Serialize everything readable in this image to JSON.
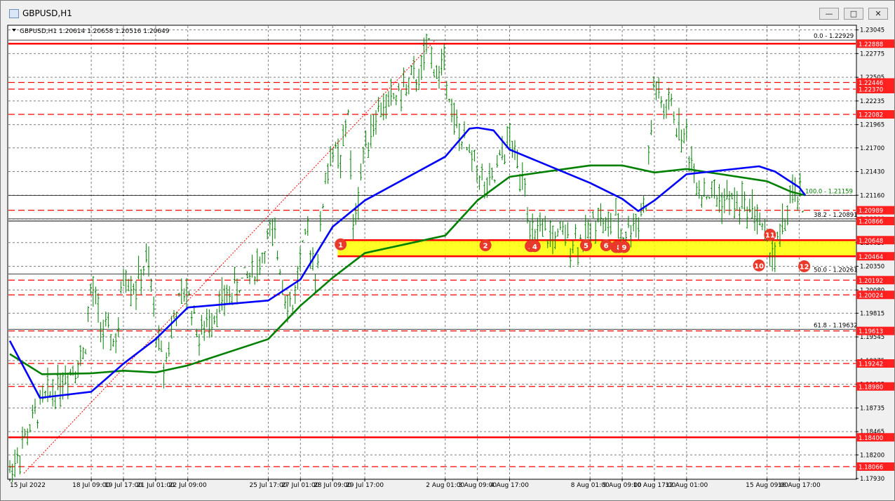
{
  "window": {
    "title": "GBPUSD,H1",
    "buttons": {
      "minimize": "—",
      "maximize": "□",
      "close": "✕"
    }
  },
  "chart_header": "GBPUSD,H1  1.20614 1.20658 1.20516 1.20649",
  "colors": {
    "price_label_bg": "#ff2020",
    "support_zone": "#ffff00",
    "sma100": "#0000ff",
    "sma200": "#008000",
    "bars": "#008000",
    "grid": "#7f7f7f"
  },
  "chart_data": {
    "type": "line",
    "series_type": "ohlc-hourly-bars",
    "symbol": "GBPUSD",
    "timeframe": "H1",
    "ohlc_last": {
      "open": 1.20614,
      "high": 1.20658,
      "low": 1.20516,
      "close": 1.20649
    },
    "ylim": [
      1.1793,
      1.2309
    ],
    "y_ticks": [
      "1.23045",
      "1.22775",
      "1.22505",
      "1.22235",
      "1.21965",
      "1.21700",
      "1.21430",
      "1.21160",
      "1.20890",
      "1.20620",
      "1.20350",
      "1.20080",
      "1.19815",
      "1.19545",
      "1.19275",
      "1.19005",
      "1.18735",
      "1.18465",
      "1.18200",
      "1.17930"
    ],
    "x_ticks": [
      "15 Jul 2022",
      "18 Jul 09:00",
      "19 Jul 17:00",
      "21 Jul 01:00",
      "22 Jul 09:00",
      "25 Jul 17:00",
      "27 Jul 01:00",
      "28 Jul 09:00",
      "29 Jul 17:00",
      "2 Aug 01:00",
      "3 Aug 09:00",
      "4 Aug 17:00",
      "8 Aug 01:00",
      "9 Aug 09:00",
      "10 Aug 17:00",
      "12 Aug 01:00",
      "15 Aug 09:00",
      "16 Aug 17:00"
    ],
    "levels": [
      {
        "value": 1.22888,
        "label": "1.22888",
        "style": "solid"
      },
      {
        "value": 1.22446,
        "label": "1.22446",
        "style": "dashed"
      },
      {
        "value": 1.2237,
        "label": "1.22370",
        "style": "dashed"
      },
      {
        "value": 1.22082,
        "label": "1.22082",
        "style": "dashed"
      },
      {
        "value": 1.20989,
        "label": "1.20989",
        "style": "dashed"
      },
      {
        "value": 1.20866,
        "label": "1.20866",
        "style": "black"
      },
      {
        "value": 1.20648,
        "label": "1.20648",
        "style": "solid"
      },
      {
        "value": 1.20464,
        "label": "1.20464",
        "style": "solid"
      },
      {
        "value": 1.20192,
        "label": "1.20192",
        "style": "dashed"
      },
      {
        "value": 1.20024,
        "label": "1.20024",
        "style": "dashed"
      },
      {
        "value": 1.19613,
        "label": "1.19613",
        "style": "dashed"
      },
      {
        "value": 1.19242,
        "label": "1.19242",
        "style": "dashed"
      },
      {
        "value": 1.1898,
        "label": "1.18980",
        "style": "dashed"
      },
      {
        "value": 1.184,
        "label": "1.18400",
        "style": "solid"
      },
      {
        "value": 1.18066,
        "label": "1.18066",
        "style": "dashed"
      }
    ],
    "fibonacci": [
      {
        "value": 1.22929,
        "label": "0.0 - 1.22929"
      },
      {
        "value": 1.21159,
        "label": "100.0 - 1.21159"
      },
      {
        "value": 1.20891,
        "label": "38.2 - 1.20891"
      },
      {
        "value": 1.20261,
        "label": "50.0 - 1.20261"
      },
      {
        "value": 1.19632,
        "label": "61.8 - 1.19632"
      }
    ],
    "support_zone": {
      "low": 1.20464,
      "high": 1.20648
    },
    "touch_markers": [
      {
        "label": "1",
        "x": "28 Jul 17:00",
        "y": 1.206
      },
      {
        "label": "2",
        "x": "3 Aug 17:00",
        "y": 1.2059
      },
      {
        "label": "3",
        "x": "5 Aug 14:00",
        "y": 1.2058
      },
      {
        "label": "4",
        "x": "5 Aug 18:00",
        "y": 1.2058
      },
      {
        "label": "5",
        "x": "7 Aug 21:00",
        "y": 1.2059
      },
      {
        "label": "6",
        "x": "8 Aug 17:00",
        "y": 1.2059
      },
      {
        "label": "7",
        "x": "9 Aug 03:00",
        "y": 1.2057
      },
      {
        "label": "8",
        "x": "9 Aug 06:00",
        "y": 1.2057
      },
      {
        "label": "9",
        "x": "9 Aug 11:00",
        "y": 1.2057
      },
      {
        "label": "10",
        "x": "15 Aug 01:00",
        "y": 1.2036
      },
      {
        "label": "11",
        "x": "15 Aug 12:00",
        "y": 1.2071
      },
      {
        "label": "12",
        "x": "16 Aug 22:00",
        "y": 1.2035
      }
    ],
    "price_path": [
      [
        "15 Jul 2022",
        1.1802
      ],
      [
        "16 Jul 08:00",
        1.188
      ],
      [
        "18 Jul 02:00",
        1.1935
      ],
      [
        "18 Jul 09:00",
        1.2012
      ],
      [
        "18 Jul 21:00",
        1.196
      ],
      [
        "19 Jul 11:00",
        1.1948
      ],
      [
        "19 Jul 17:00",
        1.203
      ],
      [
        "20 Jul 05:00",
        1.201
      ],
      [
        "20 Jul 17:00",
        1.2042
      ],
      [
        "21 Jul 01:00",
        1.1965
      ],
      [
        "21 Jul 09:00",
        1.192
      ],
      [
        "21 Jul 21:00",
        1.1985
      ],
      [
        "22 Jul 09:00",
        1.2008
      ],
      [
        "22 Jul 21:00",
        1.195
      ],
      [
        "23 Jul 08:00",
        1.198
      ],
      [
        "25 Jul 09:00",
        1.204
      ],
      [
        "25 Jul 17:00",
        1.207
      ],
      [
        "26 Jul 01:00",
        1.206
      ],
      [
        "26 Jul 09:00",
        1.201
      ],
      [
        "26 Jul 17:00",
        1.1985
      ],
      [
        "27 Jul 01:00",
        1.2045
      ],
      [
        "27 Jul 09:00",
        1.207
      ],
      [
        "27 Jul 17:00",
        1.2025
      ],
      [
        "28 Jul 01:00",
        1.213
      ],
      [
        "28 Jul 09:00",
        1.217
      ],
      [
        "28 Jul 17:00",
        1.215
      ],
      [
        "29 Jul 01:00",
        1.222
      ],
      [
        "29 Jul 05:00",
        1.207
      ],
      [
        "29 Jul 17:00",
        1.2175
      ],
      [
        "30 Jul 05:00",
        1.221
      ],
      [
        "1 Aug 01:00",
        1.2255
      ],
      [
        "1 Aug 09:00",
        1.229
      ],
      [
        "1 Aug 17:00",
        1.225
      ],
      [
        "2 Aug 01:00",
        1.227
      ],
      [
        "2 Aug 09:00",
        1.22
      ],
      [
        "2 Aug 17:00",
        1.218
      ],
      [
        "3 Aug 01:00",
        1.216
      ],
      [
        "3 Aug 09:00",
        1.215
      ],
      [
        "3 Aug 17:00",
        1.212
      ],
      [
        "4 Aug 01:00",
        1.213
      ],
      [
        "4 Aug 09:00",
        1.216
      ],
      [
        "4 Aug 17:00",
        1.218
      ],
      [
        "5 Aug 01:00",
        1.215
      ],
      [
        "5 Aug 09:00",
        1.214
      ],
      [
        "5 Aug 13:00",
        1.206
      ],
      [
        "5 Aug 17:00",
        1.207
      ],
      [
        "7 Aug 21:00",
        1.2065
      ],
      [
        "8 Aug 09:00",
        1.21
      ],
      [
        "8 Aug 17:00",
        1.2075
      ],
      [
        "9 Aug 01:00",
        1.209
      ],
      [
        "9 Aug 09:00",
        1.207
      ],
      [
        "9 Aug 17:00",
        1.208
      ],
      [
        "10 Aug 01:00",
        1.209
      ],
      [
        "10 Aug 09:00",
        1.211
      ],
      [
        "10 Aug 17:00",
        1.225
      ],
      [
        "11 Aug 01:00",
        1.221
      ],
      [
        "11 Aug 09:00",
        1.222
      ],
      [
        "11 Aug 17:00",
        1.219
      ],
      [
        "12 Aug 01:00",
        1.218
      ],
      [
        "12 Aug 09:00",
        1.214
      ],
      [
        "12 Aug 17:00",
        1.212
      ],
      [
        "14 Aug 21:00",
        1.21
      ],
      [
        "15 Aug 09:00",
        1.206
      ],
      [
        "15 Aug 17:00",
        1.205
      ],
      [
        "16 Aug 01:00",
        1.208
      ],
      [
        "16 Aug 09:00",
        1.211
      ],
      [
        "16 Aug 17:00",
        1.212
      ],
      [
        "16 Aug 23:00",
        1.2065
      ]
    ],
    "sma100": [
      [
        "15 Jul 2022",
        1.195
      ],
      [
        "16 Jul 06:00",
        1.1885
      ],
      [
        "18 Jul 09:00",
        1.1892
      ],
      [
        "19 Jul 17:00",
        1.1924
      ],
      [
        "21 Jul 01:00",
        1.1952
      ],
      [
        "22 Jul 09:00",
        1.1988
      ],
      [
        "25 Jul 17:00",
        1.1996
      ],
      [
        "27 Jul 01:00",
        1.202
      ],
      [
        "28 Jul 09:00",
        1.208
      ],
      [
        "29 Jul 17:00",
        1.211
      ],
      [
        "2 Aug 01:00",
        1.216
      ],
      [
        "3 Aug 01:00",
        1.2192
      ],
      [
        "3 Aug 09:00",
        1.2193
      ],
      [
        "4 Aug 01:00",
        1.219
      ],
      [
        "4 Aug 17:00",
        1.2168
      ],
      [
        "8 Aug 01:00",
        1.213
      ],
      [
        "9 Aug 09:00",
        1.2112
      ],
      [
        "10 Aug 01:00",
        1.2098
      ],
      [
        "10 Aug 17:00",
        1.211
      ],
      [
        "12 Aug 01:00",
        1.214
      ],
      [
        "15 Aug 01:00",
        1.2149
      ],
      [
        "15 Aug 17:00",
        1.2143
      ],
      [
        "16 Aug 17:00",
        1.2125
      ],
      [
        "16 Aug 23:00",
        1.2116
      ]
    ],
    "sma200": [
      [
        "15 Jul 2022",
        1.1935
      ],
      [
        "16 Jul 08:00",
        1.1912
      ],
      [
        "18 Jul 09:00",
        1.1913
      ],
      [
        "19 Jul 17:00",
        1.1916
      ],
      [
        "21 Jul 01:00",
        1.1914
      ],
      [
        "22 Jul 09:00",
        1.1922
      ],
      [
        "25 Jul 17:00",
        1.1952
      ],
      [
        "27 Jul 01:00",
        1.199
      ],
      [
        "28 Jul 09:00",
        1.2022
      ],
      [
        "29 Jul 17:00",
        1.205
      ],
      [
        "2 Aug 01:00",
        1.207
      ],
      [
        "3 Aug 09:00",
        1.211
      ],
      [
        "4 Aug 17:00",
        1.2137
      ],
      [
        "8 Aug 01:00",
        1.215
      ],
      [
        "9 Aug 09:00",
        1.215
      ],
      [
        "10 Aug 17:00",
        1.2142
      ],
      [
        "12 Aug 01:00",
        1.2146
      ],
      [
        "15 Aug 09:00",
        1.2132
      ],
      [
        "16 Aug 09:00",
        1.212
      ],
      [
        "16 Aug 23:00",
        1.2116
      ]
    ]
  }
}
